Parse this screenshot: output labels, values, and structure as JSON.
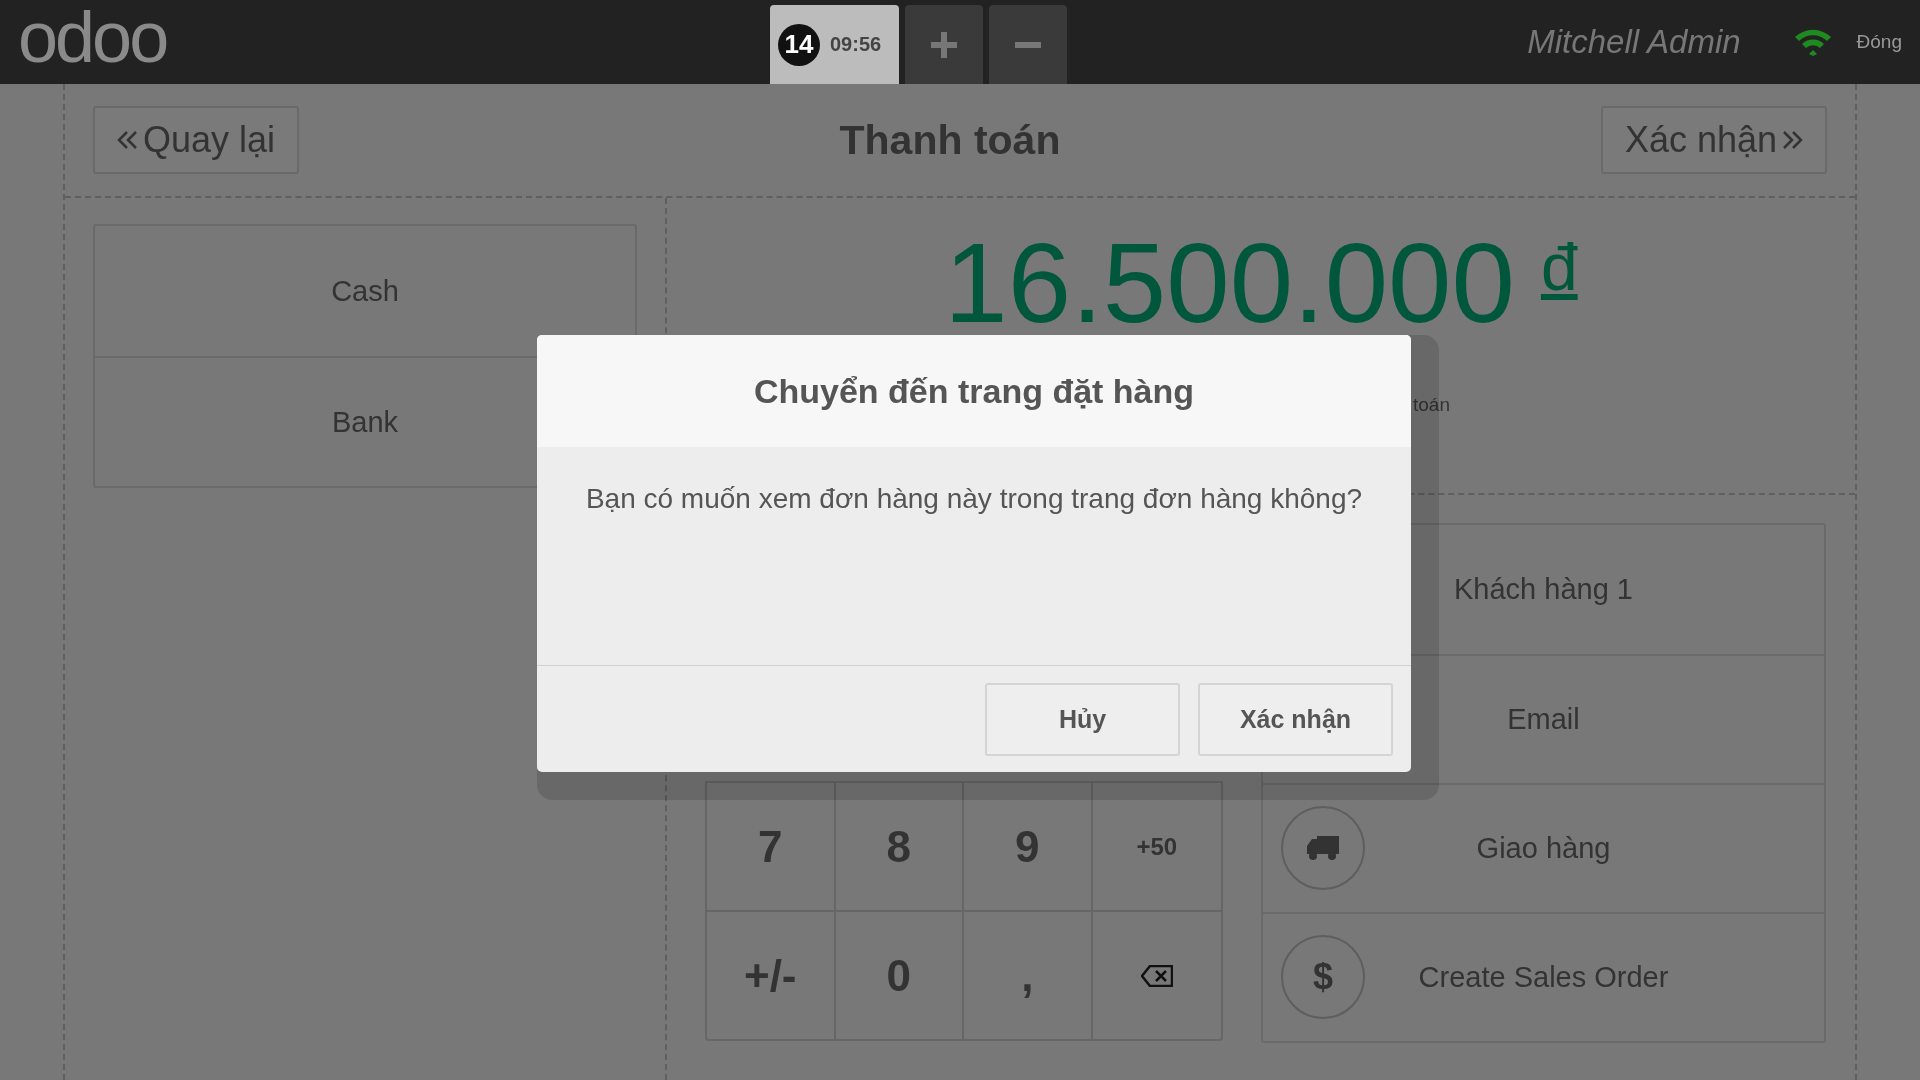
{
  "navbar": {
    "logo": "odoo",
    "order_tab": {
      "number": "14",
      "time": "09:56",
      "selected": true
    },
    "user": "Mitchell Admin",
    "close_label": "Đóng"
  },
  "header": {
    "back": "Quay lại",
    "title": "Thanh toán",
    "next": "Xác nhận"
  },
  "payment_methods": [
    "Cash",
    "Bank"
  ],
  "amount": {
    "value": "16.500.000",
    "currency": "đ"
  },
  "hint_fragment": "toán",
  "numpad": [
    [
      {
        "kind": "text",
        "label": "7"
      },
      {
        "kind": "text",
        "label": "8"
      },
      {
        "kind": "text",
        "label": "9"
      },
      {
        "kind": "small",
        "label": "+50"
      }
    ],
    [
      {
        "kind": "text",
        "label": "+/-"
      },
      {
        "kind": "text",
        "label": "0"
      },
      {
        "kind": "text",
        "label": ","
      },
      {
        "kind": "backspace"
      }
    ]
  ],
  "actions": [
    {
      "kind": "plain",
      "label": "Khách hàng 1"
    },
    {
      "kind": "plain",
      "label": "Email"
    },
    {
      "kind": "truck",
      "label": "Giao hàng"
    },
    {
      "kind": "symbol",
      "icon_char": "$",
      "label": "Create Sales Order"
    }
  ],
  "dialog": {
    "title": "Chuyển đến trang đặt hàng",
    "body": "Bạn có muốn xem đơn hàng này trong trang đơn hàng không?",
    "buttons": [
      "Hủy",
      "Xác nhận"
    ]
  }
}
